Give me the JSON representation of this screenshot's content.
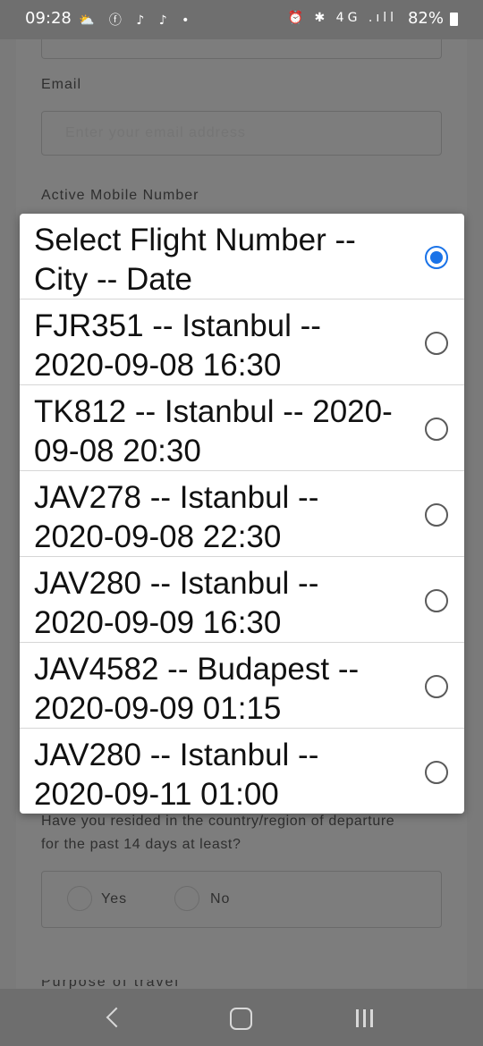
{
  "status_bar": {
    "time": "09:28",
    "notification_icons": "⛅ ⓕ ♪ ♪ •",
    "system_icons": "⏰ ✱ 4G .ıll",
    "battery": "82%"
  },
  "form": {
    "email_label": "Email",
    "email_placeholder": "Enter your email address",
    "mobile_label": "Active Mobile Number",
    "residence_question": "Have you resided in the country/region of departure for the past 14 days at least?",
    "yes_label": "Yes",
    "no_label": "No",
    "purpose_label": "Purpose of travel"
  },
  "dialog": {
    "options": [
      {
        "label": "Select Flight Number -- City -- Date",
        "selected": true
      },
      {
        "label": "FJR351 -- Istanbul -- 2020-09-08 16:30",
        "selected": false
      },
      {
        "label": "TK812 -- Istanbul -- 2020-09-08 20:30",
        "selected": false
      },
      {
        "label": "JAV278 -- Istanbul -- 2020-09-08 22:30",
        "selected": false
      },
      {
        "label": "JAV280 -- Istanbul -- 2020-09-09 16:30",
        "selected": false
      },
      {
        "label": "JAV4582 -- Budapest -- 2020-09-09 01:15",
        "selected": false
      },
      {
        "label": "JAV280 -- Istanbul -- 2020-09-11 01:00",
        "selected": false
      }
    ]
  },
  "colors": {
    "accent": "#1a73e8",
    "scrim": "#7a7a7a",
    "dialog_bg": "#ffffff"
  },
  "icons": {
    "nav_back": "chevron-left-icon",
    "nav_home": "home-icon",
    "nav_recents": "recents-icon"
  }
}
